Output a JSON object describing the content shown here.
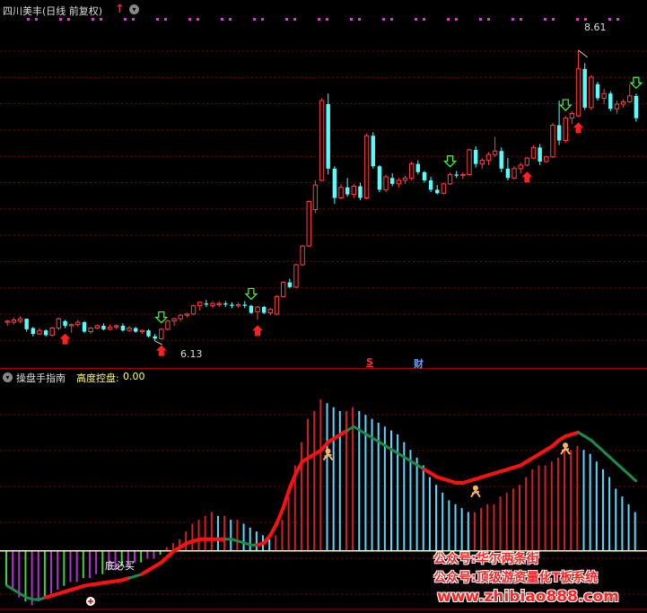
{
  "top_panel": {
    "title": "四川美丰(日线 前复权)",
    "high_label": "8.61",
    "low_label": "6.13",
    "marker_s": "S",
    "marker_cai": "财"
  },
  "bottom_panel": {
    "title": "操盘手指南",
    "metric_label": "高度控盘:",
    "metric_value": "0.00",
    "buy_label": "底必买"
  },
  "watermark": {
    "line1": "公众号:华尔两条街",
    "line2": "公众号:顶级游资量化T板系统",
    "line3": "www.zhibiao888.com"
  },
  "colors": {
    "up": "#ff4040",
    "down": "#54ffff",
    "grid": "#7a0000",
    "hist_up": "#d02020",
    "hist_down": "#5ad8ff",
    "hist_neg_a": "#b030d0",
    "hist_neg_b": "#40d040",
    "ribbon_red": "#ff1010",
    "ribbon_green": "#1e8a4e",
    "zero_line": "#ffffa0"
  },
  "chart_data": [
    {
      "type": "candlestick",
      "title": "四川美丰(日线 前复权)",
      "ylim": [
        5.9,
        8.9
      ],
      "annotations": [
        {
          "label": "8.61",
          "value": 8.61
        },
        {
          "label": "6.13",
          "value": 6.13
        }
      ],
      "candles": [
        [
          6.29,
          6.31,
          6.26,
          6.3
        ],
        [
          6.29,
          6.33,
          6.27,
          6.31
        ],
        [
          6.3,
          6.34,
          6.28,
          6.32
        ],
        [
          6.32,
          6.32,
          6.21,
          6.23
        ],
        [
          6.24,
          6.25,
          6.17,
          6.19
        ],
        [
          6.19,
          6.24,
          6.18,
          6.22
        ],
        [
          6.22,
          6.23,
          6.17,
          6.18
        ],
        [
          6.18,
          6.25,
          6.17,
          6.24
        ],
        [
          6.24,
          6.33,
          6.22,
          6.32
        ],
        [
          6.3,
          6.31,
          6.24,
          6.26
        ],
        [
          6.26,
          6.28,
          6.2,
          6.27
        ],
        [
          6.27,
          6.31,
          6.25,
          6.29
        ],
        [
          6.29,
          6.3,
          6.2,
          6.21
        ],
        [
          6.21,
          6.25,
          6.19,
          6.24
        ],
        [
          6.24,
          6.27,
          6.23,
          6.26
        ],
        [
          6.26,
          6.28,
          6.22,
          6.23
        ],
        [
          6.23,
          6.27,
          6.22,
          6.25
        ],
        [
          6.25,
          6.27,
          6.23,
          6.26
        ],
        [
          6.26,
          6.28,
          6.21,
          6.22
        ],
        [
          6.22,
          6.26,
          6.21,
          6.24
        ],
        [
          6.24,
          6.25,
          6.2,
          6.21
        ],
        [
          6.21,
          6.23,
          6.19,
          6.22
        ],
        [
          6.22,
          6.23,
          6.16,
          6.17
        ],
        [
          6.17,
          6.19,
          6.13,
          6.15
        ],
        [
          6.15,
          6.24,
          6.14,
          6.23
        ],
        [
          6.23,
          6.31,
          6.22,
          6.3
        ],
        [
          6.3,
          6.33,
          6.26,
          6.32
        ],
        [
          6.32,
          6.36,
          6.3,
          6.35
        ],
        [
          6.35,
          6.37,
          6.33,
          6.36
        ],
        [
          6.36,
          6.44,
          6.35,
          6.43
        ],
        [
          6.43,
          6.47,
          6.39,
          6.46
        ],
        [
          6.45,
          6.48,
          6.42,
          6.44
        ],
        [
          6.43,
          6.47,
          6.41,
          6.45
        ],
        [
          6.44,
          6.47,
          6.42,
          6.45
        ],
        [
          6.45,
          6.47,
          6.42,
          6.44
        ],
        [
          6.44,
          6.46,
          6.41,
          6.43
        ],
        [
          6.43,
          6.46,
          6.41,
          6.44
        ],
        [
          6.44,
          6.47,
          6.41,
          6.43
        ],
        [
          6.43,
          6.44,
          6.36,
          6.37
        ],
        [
          6.38,
          6.43,
          6.31,
          6.42
        ],
        [
          6.42,
          6.43,
          6.36,
          6.37
        ],
        [
          6.37,
          6.41,
          6.35,
          6.4
        ],
        [
          6.36,
          6.52,
          6.35,
          6.51
        ],
        [
          6.51,
          6.64,
          6.5,
          6.63
        ],
        [
          6.63,
          6.66,
          6.58,
          6.59
        ],
        [
          6.59,
          6.79,
          6.58,
          6.78
        ],
        [
          6.78,
          6.95,
          6.77,
          6.94
        ],
        [
          6.94,
          7.33,
          6.93,
          7.32
        ],
        [
          7.25,
          7.5,
          7.22,
          7.46
        ],
        [
          7.5,
          8.2,
          7.49,
          8.18
        ],
        [
          8.15,
          8.24,
          7.55,
          7.6
        ],
        [
          7.6,
          7.62,
          7.3,
          7.35
        ],
        [
          7.35,
          7.47,
          7.34,
          7.44
        ],
        [
          7.44,
          7.52,
          7.36,
          7.38
        ],
        [
          7.38,
          7.47,
          7.35,
          7.45
        ],
        [
          7.45,
          7.48,
          7.33,
          7.35
        ],
        [
          7.35,
          7.9,
          7.34,
          7.88
        ],
        [
          7.88,
          7.91,
          7.6,
          7.62
        ],
        [
          7.62,
          7.63,
          7.4,
          7.42
        ],
        [
          7.42,
          7.55,
          7.4,
          7.53
        ],
        [
          7.52,
          7.56,
          7.45,
          7.47
        ],
        [
          7.47,
          7.52,
          7.44,
          7.5
        ],
        [
          7.5,
          7.54,
          7.47,
          7.52
        ],
        [
          7.52,
          7.66,
          7.5,
          7.64
        ],
        [
          7.64,
          7.67,
          7.55,
          7.57
        ],
        [
          7.57,
          7.58,
          7.48,
          7.5
        ],
        [
          7.5,
          7.53,
          7.4,
          7.42
        ],
        [
          7.42,
          7.46,
          7.38,
          7.39
        ],
        [
          7.39,
          7.48,
          7.38,
          7.47
        ],
        [
          7.47,
          7.57,
          7.46,
          7.55
        ],
        [
          7.55,
          7.58,
          7.52,
          7.54
        ],
        [
          7.54,
          7.57,
          7.51,
          7.55
        ],
        [
          7.55,
          7.77,
          7.54,
          7.76
        ],
        [
          7.76,
          7.79,
          7.61,
          7.64
        ],
        [
          7.64,
          7.69,
          7.6,
          7.67
        ],
        [
          7.67,
          7.74,
          7.63,
          7.72
        ],
        [
          7.72,
          7.87,
          7.7,
          7.75
        ],
        [
          7.75,
          7.78,
          7.57,
          7.6
        ],
        [
          7.6,
          7.69,
          7.5,
          7.52
        ],
        [
          7.52,
          7.62,
          7.51,
          7.6
        ],
        [
          7.6,
          7.65,
          7.56,
          7.63
        ],
        [
          7.63,
          7.7,
          7.62,
          7.69
        ],
        [
          7.69,
          7.8,
          7.68,
          7.78
        ],
        [
          7.78,
          7.81,
          7.63,
          7.66
        ],
        [
          7.66,
          7.71,
          7.65,
          7.7
        ],
        [
          7.7,
          7.99,
          7.69,
          7.97
        ],
        [
          7.97,
          8.18,
          7.8,
          7.84
        ],
        [
          7.84,
          8.05,
          7.82,
          8.03
        ],
        [
          8.03,
          8.09,
          7.98,
          8.07
        ],
        [
          8.05,
          8.61,
          8.04,
          8.45
        ],
        [
          8.45,
          8.5,
          8.1,
          8.12
        ],
        [
          8.12,
          8.4,
          8.1,
          8.38
        ],
        [
          8.32,
          8.34,
          8.18,
          8.2
        ],
        [
          8.2,
          8.28,
          8.15,
          8.24
        ],
        [
          8.24,
          8.26,
          8.09,
          8.11
        ],
        [
          8.11,
          8.18,
          8.07,
          8.15
        ],
        [
          8.15,
          8.19,
          8.12,
          8.17
        ],
        [
          8.17,
          8.32,
          8.16,
          8.22
        ],
        [
          8.22,
          8.24,
          8.0,
          8.03
        ]
      ],
      "down_arrows": [
        24,
        38,
        69,
        87,
        98
      ],
      "up_arrows": [
        9,
        24,
        39,
        81,
        89
      ],
      "s_marker": 63,
      "cai_marker": 72
    },
    {
      "type": "bar",
      "title": "操盘手指南",
      "ylim": [
        -1.6,
        4.2
      ],
      "values": [
        -0.9,
        -1.0,
        -1.2,
        -1.3,
        -1.4,
        -1.3,
        -1.2,
        -1.1,
        -1.0,
        -0.9,
        -0.8,
        -0.8,
        -0.7,
        -0.7,
        -0.6,
        -0.6,
        -0.5,
        -0.5,
        -0.4,
        -0.4,
        -0.3,
        -0.3,
        -0.2,
        -0.2,
        -0.1,
        0.1,
        0.2,
        0.3,
        0.5,
        0.7,
        0.8,
        0.9,
        1.0,
        0.9,
        0.9,
        0.8,
        0.8,
        0.7,
        0.6,
        0.5,
        0.4,
        0.3,
        0.4,
        0.8,
        1.4,
        2.2,
        2.8,
        3.4,
        3.6,
        3.9,
        3.8,
        3.7,
        3.6,
        3.6,
        3.7,
        3.6,
        3.5,
        3.4,
        3.3,
        3.2,
        3.1,
        3.0,
        2.8,
        2.6,
        2.4,
        2.2,
        1.9,
        1.7,
        1.5,
        1.3,
        1.2,
        1.1,
        1.0,
        1.0,
        1.1,
        1.2,
        1.2,
        1.4,
        1.5,
        1.6,
        1.7,
        1.9,
        2.1,
        2.2,
        2.2,
        2.3,
        2.4,
        2.6,
        2.6,
        2.7,
        2.6,
        2.5,
        2.3,
        2.1,
        1.9,
        1.6,
        1.4,
        1.2,
        1.0
      ],
      "signal_line": [
        -0.9,
        -1.0,
        -1.1,
        -1.2,
        -1.25,
        -1.25,
        -1.2,
        -1.15,
        -1.1,
        -1.05,
        -1.0,
        -0.95,
        -0.9,
        -0.87,
        -0.85,
        -0.82,
        -0.8,
        -0.78,
        -0.75,
        -0.7,
        -0.65,
        -0.6,
        -0.5,
        -0.4,
        -0.3,
        -0.15,
        0.0,
        0.1,
        0.2,
        0.25,
        0.3,
        0.3,
        0.3,
        0.3,
        0.3,
        0.3,
        0.25,
        0.2,
        0.15,
        0.15,
        0.2,
        0.4,
        0.7,
        1.1,
        1.6,
        2.0,
        2.3,
        2.4,
        2.5,
        2.6,
        2.8,
        2.9,
        3.0,
        3.1,
        3.2,
        3.1,
        3.0,
        2.9,
        2.8,
        2.7,
        2.6,
        2.5,
        2.4,
        2.3,
        2.2,
        2.1,
        2.0,
        1.9,
        1.85,
        1.8,
        1.75,
        1.75,
        1.8,
        1.85,
        1.9,
        1.95,
        2.0,
        2.05,
        2.1,
        2.15,
        2.2,
        2.3,
        2.4,
        2.5,
        2.6,
        2.7,
        2.85,
        2.95,
        3.0,
        3.05,
        2.95,
        2.85,
        2.7,
        2.55,
        2.4,
        2.25,
        2.1,
        1.95,
        1.8
      ],
      "signal_colors": [
        "green",
        "green",
        "green",
        "green",
        "green",
        "green",
        "red",
        "red",
        "red",
        "red",
        "red",
        "red",
        "red",
        "red",
        "red",
        "red",
        "red",
        "red",
        "red",
        "green",
        "green",
        "red",
        "red",
        "red",
        "red",
        "red",
        "red",
        "red",
        "red",
        "red",
        "red",
        "red",
        "red",
        "red",
        "green",
        "green",
        "green",
        "green",
        "green",
        "red",
        "red",
        "red",
        "red",
        "red",
        "red",
        "red",
        "red",
        "red",
        "red",
        "red",
        "red",
        "red",
        "red",
        "green",
        "green",
        "green",
        "green",
        "green",
        "green",
        "green",
        "green",
        "green",
        "green",
        "green",
        "green",
        "red",
        "red",
        "red",
        "red",
        "red",
        "red",
        "red",
        "red",
        "red",
        "red",
        "red",
        "red",
        "red",
        "red",
        "red",
        "red",
        "red",
        "red",
        "red",
        "red",
        "red",
        "red",
        "red",
        "red",
        "green",
        "green",
        "green",
        "green",
        "green",
        "green",
        "green",
        "green",
        "green",
        "green"
      ],
      "markers": [
        {
          "index": 50,
          "type": "runner"
        },
        {
          "index": 73,
          "type": "runner"
        },
        {
          "index": 87,
          "type": "runner"
        },
        {
          "index": 13,
          "type": "buy"
        }
      ]
    }
  ]
}
